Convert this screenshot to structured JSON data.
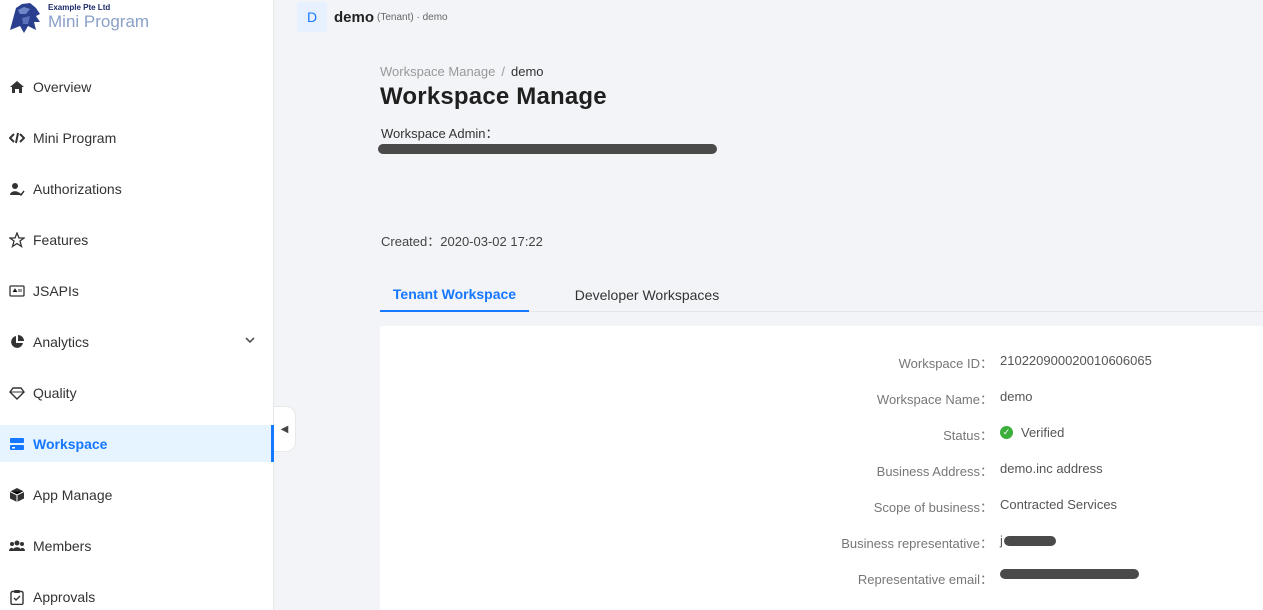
{
  "brand": {
    "company": "Example Pte Ltd",
    "product": "Mini Program"
  },
  "sidebar": {
    "items": [
      {
        "label": "Overview",
        "icon": "home-icon"
      },
      {
        "label": "Mini Program",
        "icon": "code-link-icon"
      },
      {
        "label": "Authorizations",
        "icon": "user-check-icon"
      },
      {
        "label": "Features",
        "icon": "star-icon"
      },
      {
        "label": "JSAPIs",
        "icon": "api-icon"
      },
      {
        "label": "Analytics",
        "icon": "pie-chart-icon",
        "expandable": true
      },
      {
        "label": "Quality",
        "icon": "diamond-icon"
      },
      {
        "label": "Workspace",
        "icon": "workspace-icon",
        "active": true
      },
      {
        "label": "App Manage",
        "icon": "box-icon"
      },
      {
        "label": "Members",
        "icon": "team-icon"
      },
      {
        "label": "Approvals",
        "icon": "clipboard-icon"
      }
    ]
  },
  "tenant": {
    "avatar_letter": "D",
    "name": "demo",
    "meta": "(Tenant) · demo"
  },
  "breadcrumb": {
    "parent": "Workspace Manage",
    "separator": "/",
    "current": "demo"
  },
  "page": {
    "title": "Workspace Manage",
    "admin_label": "Workspace Admin：",
    "created_label": "Created：",
    "created_value": "2020-03-02 17:22"
  },
  "tabs": [
    {
      "label": "Tenant Workspace",
      "active": true
    },
    {
      "label": "Developer Workspaces",
      "active": false
    }
  ],
  "details": {
    "workspace_id_label": "Workspace ID：",
    "workspace_id": "21022090002001060606​5",
    "workspace_name_label": "Workspace Name：",
    "workspace_name": "demo",
    "status_label": "Status：",
    "status": "Verified",
    "business_address_label": "Business Address：",
    "business_address": "demo.inc address",
    "scope_label": "Scope of business：",
    "scope": "Contracted Services",
    "representative_label": "Business representative：",
    "representative_prefix": "j",
    "email_label": "Representative email："
  },
  "colors": {
    "accent": "#1677ff",
    "active_bg": "#e6f4ff",
    "success": "#3cae3c"
  }
}
